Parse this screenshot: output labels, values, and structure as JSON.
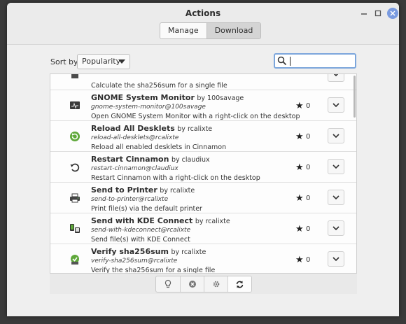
{
  "window": {
    "title": "Actions",
    "switcher": {
      "manage": "Manage",
      "download": "Download",
      "active": "Download"
    }
  },
  "toolbar": {
    "sort_label": "Sort by",
    "sort_value": "Popularity",
    "search_value": ""
  },
  "list": {
    "partial_row_desc": "Calculate the sha256sum for a single file",
    "items": [
      {
        "title": "GNOME System Monitor",
        "by": "by 100savage",
        "uuid": "gnome-system-monitor@100savage",
        "desc": "Open GNOME System Monitor with a right-click on the desktop",
        "score": "0",
        "icon": "system-monitor-icon"
      },
      {
        "title": "Reload All Desklets",
        "by": "by rcalixte",
        "uuid": "reload-all-desklets@rcalixte",
        "desc": "Reload all enabled desklets in Cinnamon",
        "score": "0",
        "icon": "reload-desklets-icon"
      },
      {
        "title": "Restart Cinnamon",
        "by": "by claudiux",
        "uuid": "restart-cinnamon@claudiux",
        "desc": "Restart Cinnamon with a right-click on the desktop",
        "score": "0",
        "icon": "restart-icon"
      },
      {
        "title": "Send to Printer",
        "by": "by rcalixte",
        "uuid": "send-to-printer@rcalixte",
        "desc": "Print file(s) via the default printer",
        "score": "0",
        "icon": "printer-icon"
      },
      {
        "title": "Send with KDE Connect",
        "by": "by rcalixte",
        "uuid": "send-with-kdeconnect@rcalixte",
        "desc": "Send file(s) with KDE Connect",
        "score": "0",
        "icon": "kde-connect-icon"
      },
      {
        "title": "Verify sha256sum",
        "by": "by rcalixte",
        "uuid": "verify-sha256sum@rcalixte",
        "desc": "Verify the sha256sum for a single file",
        "score": "0",
        "icon": "verify-checksum-icon"
      }
    ]
  },
  "bottom_toolbar": {
    "buttons": [
      "info-icon",
      "uninstall-icon",
      "configure-icon",
      "refresh-icon"
    ],
    "active": "refresh-icon"
  },
  "colors": {
    "accent": "#7ca6dc",
    "close_button": "#7a9be0"
  }
}
